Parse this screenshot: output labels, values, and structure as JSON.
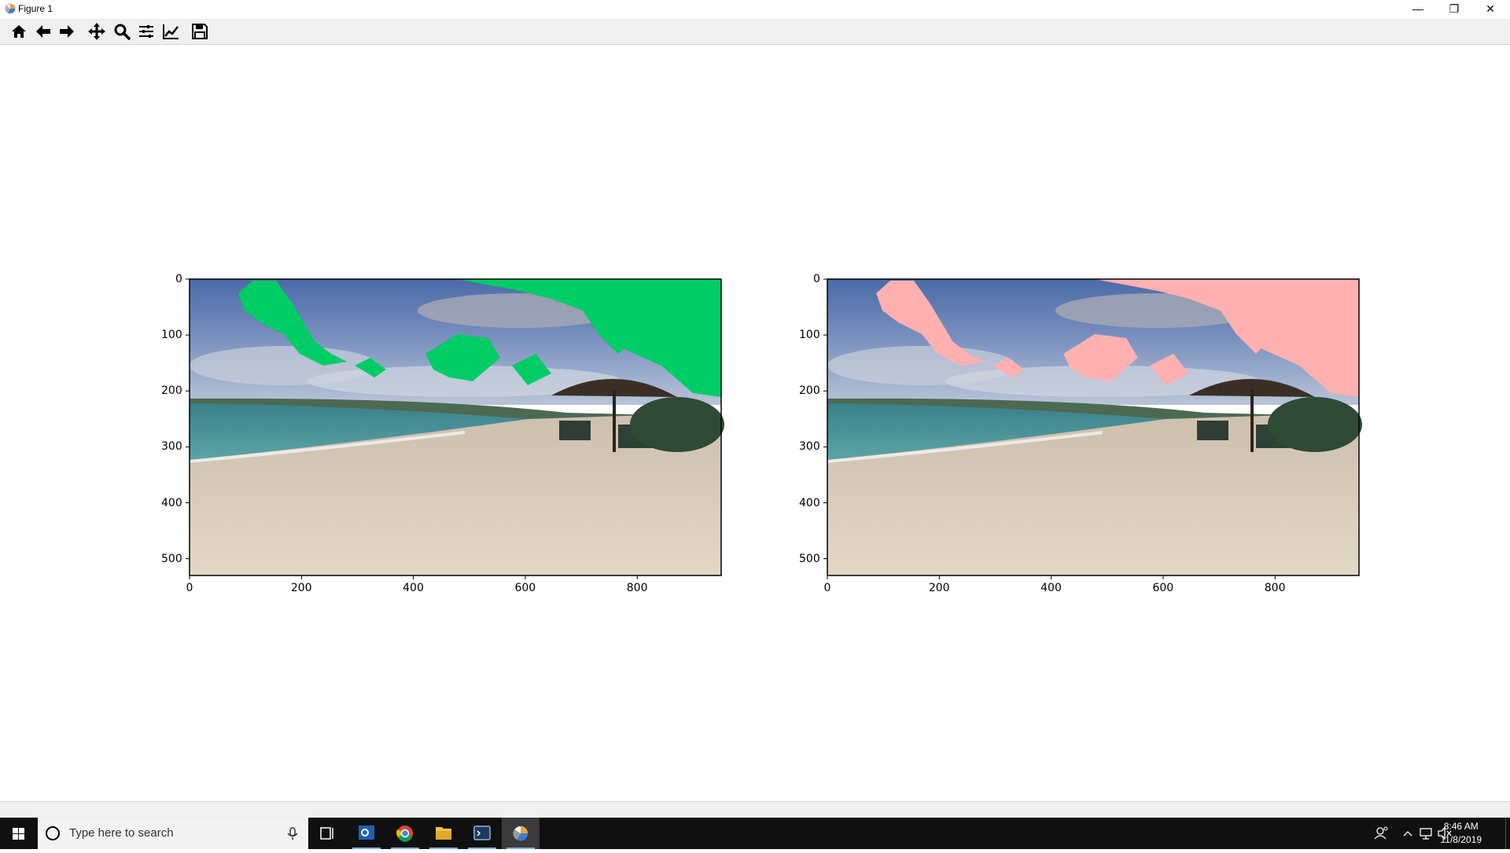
{
  "window": {
    "title": "Figure 1",
    "controls": {
      "minimize": "—",
      "restore": "❐",
      "close": "✕"
    }
  },
  "toolbar": {
    "tools": [
      {
        "name": "home-icon",
        "tooltip": "Home"
      },
      {
        "name": "back-arrow-icon",
        "tooltip": "Back"
      },
      {
        "name": "forward-arrow-icon",
        "tooltip": "Forward"
      },
      {
        "name": "pan-move-icon",
        "tooltip": "Pan"
      },
      {
        "name": "zoom-magnifier-icon",
        "tooltip": "Zoom"
      },
      {
        "name": "subplots-sliders-icon",
        "tooltip": "Subplots"
      },
      {
        "name": "edit-curves-icon",
        "tooltip": "Customize"
      },
      {
        "name": "save-floppy-icon",
        "tooltip": "Save"
      }
    ]
  },
  "figure": {
    "axes": [
      {
        "image": "beach photo with sky regions highlighted in green",
        "mask_color": "#00cc66",
        "x_ticks": [
          "0",
          "200",
          "400",
          "600",
          "800"
        ],
        "y_ticks": [
          "0",
          "100",
          "200",
          "300",
          "400",
          "500"
        ],
        "xlim": [
          0,
          950
        ],
        "ylim": [
          530,
          0
        ]
      },
      {
        "image": "beach photo with sky regions highlighted in pink",
        "mask_color": "#ffb0b0",
        "x_ticks": [
          "0",
          "200",
          "400",
          "600",
          "800"
        ],
        "y_ticks": [
          "0",
          "100",
          "200",
          "300",
          "400",
          "500"
        ],
        "xlim": [
          0,
          950
        ],
        "ylim": [
          530,
          0
        ]
      }
    ]
  },
  "taskbar": {
    "search_placeholder": "Type here to search",
    "apps": [
      "task-view-icon",
      "outlook-icon",
      "chrome-icon",
      "file-explorer-icon",
      "terminal-icon",
      "matplotlib-figure-icon"
    ],
    "time": "8:46 AM",
    "date": "11/8/2019"
  }
}
